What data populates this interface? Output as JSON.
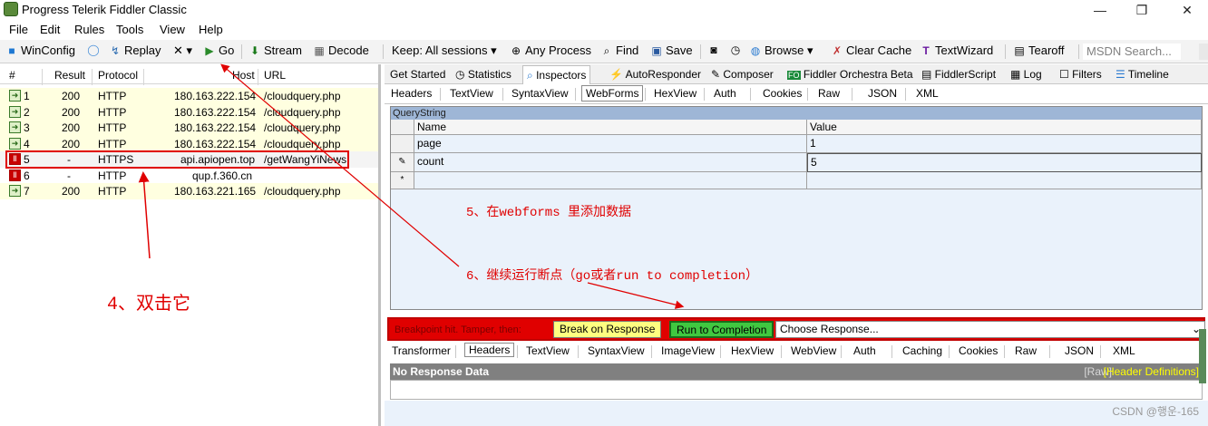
{
  "window": {
    "title": "Progress Telerik Fiddler Classic",
    "min": "—",
    "max": "❐",
    "close": "✕"
  },
  "menu": [
    "File",
    "Edit",
    "Rules",
    "Tools",
    "View",
    "Help"
  ],
  "toolbar": {
    "winconfig": "WinConfig",
    "replay": "Replay",
    "remove": "✕ ▾",
    "go": "Go",
    "stream": "Stream",
    "decode": "Decode",
    "keep": "Keep: All sessions ▾",
    "any_process": "Any Process",
    "find": "Find",
    "save": "Save",
    "browse": "Browse ▾",
    "clear_cache": "Clear Cache",
    "text_wizard": "TextWizard",
    "tearoff": "Tearoff",
    "msdn_search": "MSDN Search..."
  },
  "sessions": {
    "headers": [
      "#",
      "Result",
      "Protocol",
      "Host",
      "URL"
    ],
    "rows": [
      {
        "id": "1",
        "result": "200",
        "protocol": "HTTP",
        "host": "180.163.222.154",
        "url": "/cloudquery.php"
      },
      {
        "id": "2",
        "result": "200",
        "protocol": "HTTP",
        "host": "180.163.222.154",
        "url": "/cloudquery.php"
      },
      {
        "id": "3",
        "result": "200",
        "protocol": "HTTP",
        "host": "180.163.222.154",
        "url": "/cloudquery.php"
      },
      {
        "id": "4",
        "result": "200",
        "protocol": "HTTP",
        "host": "180.163.222.154",
        "url": "/cloudquery.php"
      },
      {
        "id": "5",
        "result": "-",
        "protocol": "HTTPS",
        "host": "api.apiopen.top",
        "url": "/getWangYiNews"
      },
      {
        "id": "6",
        "result": "-",
        "protocol": "HTTP",
        "host": "qup.f.360.cn",
        "url": ""
      },
      {
        "id": "7",
        "result": "200",
        "protocol": "HTTP",
        "host": "180.163.221.165",
        "url": "/cloudquery.php"
      }
    ]
  },
  "inspector_tabs": [
    "Get Started",
    "Statistics",
    "Inspectors",
    "AutoResponder",
    "Composer",
    "Fiddler Orchestra Beta",
    "FiddlerScript",
    "Log",
    "Filters",
    "Timeline"
  ],
  "request_tabs": [
    "Headers",
    "TextView",
    "SyntaxView",
    "WebForms",
    "HexView",
    "Auth",
    "Cookies",
    "Raw",
    "JSON",
    "XML"
  ],
  "querystring": {
    "label": "QueryString",
    "col_name": "Name",
    "col_value": "Value",
    "rows": [
      {
        "name": "page",
        "value": "1"
      },
      {
        "name": "count",
        "value": "5"
      }
    ],
    "new_row_marker": "*",
    "edit_marker": "✎"
  },
  "annotations": {
    "step4": "4、双击它",
    "step5": "5、在webforms 里添加数据",
    "step6": "6、继续运行断点（go或者run to completion）"
  },
  "breakpoint": {
    "text": "Breakpoint hit. Tamper, then:",
    "break_on_response": "Break on Response",
    "run_to_completion": "Run to Completion",
    "choose_response": "Choose Response...",
    "choose_arrow": "⌄"
  },
  "response_tabs": [
    "Transformer",
    "Headers",
    "TextView",
    "SyntaxView",
    "ImageView",
    "HexView",
    "WebView",
    "Auth",
    "Caching",
    "Cookies",
    "Raw",
    "JSON",
    "XML"
  ],
  "response": {
    "no_data": "No Response Data",
    "raw": "[Raw]",
    "header_defs": "[Header Definitions]"
  },
  "watermark": "CSDN @행운-165",
  "colors": {
    "red": "#e00000",
    "yellow_row": "#ffffe0",
    "qs_header": "#9eb6d6",
    "panel_bg": "#eaf2fb"
  }
}
